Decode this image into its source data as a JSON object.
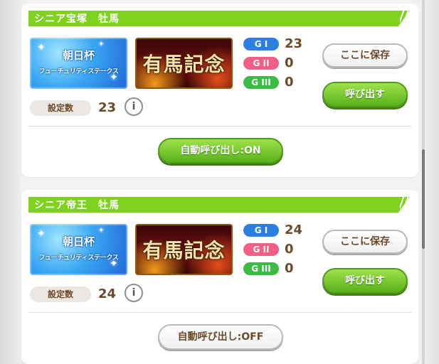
{
  "entries": [
    {
      "title": "シニア宝塚　牡馬",
      "race_cup": {
        "line1": "朝日杯",
        "line2": "フューチュリティステークス"
      },
      "race_main": {
        "label": "有馬記念"
      },
      "grades": [
        {
          "badge": "G I",
          "count": "23",
          "color": "#2c7fe0"
        },
        {
          "badge": "G II",
          "count": "0",
          "color": "#f25f86"
        },
        {
          "badge": "G III",
          "count": "0",
          "color": "#3cbb46"
        }
      ],
      "save_label": "ここに保存",
      "call_label": "呼び出す",
      "setting_label": "設定数",
      "setting_value": "23",
      "info_label": "i",
      "auto_label": "自動呼び出し:ON"
    },
    {
      "title": "シニア帝王　牡馬",
      "race_cup": {
        "line1": "朝日杯",
        "line2": "フューチュリティステークス"
      },
      "race_main": {
        "label": "有馬記念"
      },
      "grades": [
        {
          "badge": "G I",
          "count": "24",
          "color": "#2c7fe0"
        },
        {
          "badge": "G II",
          "count": "0",
          "color": "#f25f86"
        },
        {
          "badge": "G III",
          "count": "0",
          "color": "#3cbb46"
        }
      ],
      "save_label": "ここに保存",
      "call_label": "呼び出す",
      "setting_label": "設定数",
      "setting_value": "24",
      "info_label": "i",
      "auto_label": "自動呼び出し:OFF"
    }
  ],
  "colors": {
    "header_green": "#7fd21f",
    "button_green": "#59b21b",
    "text_brown": "#6b4a2a"
  }
}
